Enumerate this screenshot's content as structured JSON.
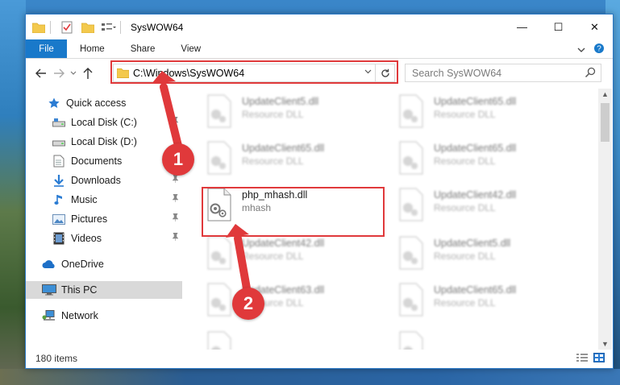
{
  "window": {
    "title": "SysWOW64",
    "controls": {
      "minimize": "—",
      "maximize": "☐",
      "close": "✕"
    }
  },
  "ribbon": {
    "tabs": [
      "File",
      "Home",
      "Share",
      "View"
    ]
  },
  "address_bar": {
    "path": "C:\\Windows\\SysWOW64"
  },
  "search": {
    "placeholder": "Search SysWOW64"
  },
  "sidebar": {
    "items": [
      {
        "label": "Quick access",
        "icon": "star-icon"
      },
      {
        "label": "Local Disk (C:)",
        "icon": "drive-icon"
      },
      {
        "label": "Local Disk (D:)",
        "icon": "drive-icon"
      },
      {
        "label": "Documents",
        "icon": "documents-icon"
      },
      {
        "label": "Downloads",
        "icon": "download-icon"
      },
      {
        "label": "Music",
        "icon": "music-icon"
      },
      {
        "label": "Pictures",
        "icon": "pictures-icon"
      },
      {
        "label": "Videos",
        "icon": "videos-icon"
      },
      {
        "label": "OneDrive",
        "icon": "cloud-icon"
      },
      {
        "label": "This PC",
        "icon": "computer-icon",
        "selected": true
      },
      {
        "label": "Network",
        "icon": "network-icon"
      }
    ]
  },
  "files": [
    {
      "name": "UpdateClient5.dll",
      "desc": "Resource DLL"
    },
    {
      "name": "UpdateClient65.dll",
      "desc": "Resource DLL"
    },
    {
      "name": "UpdateClient65.dll",
      "desc": "Resource DLL"
    },
    {
      "name": "UpdateClient65.dll",
      "desc": "Resource DLL"
    },
    {
      "name": "php_mhash.dll",
      "desc": "mhash"
    },
    {
      "name": "UpdateClient42.dll",
      "desc": "Resource DLL"
    },
    {
      "name": "UpdateClient42.dll",
      "desc": "Resource DLL"
    },
    {
      "name": "UpdateClient5.dll",
      "desc": "Resource DLL"
    },
    {
      "name": "UpdateClient63.dll",
      "desc": "Resource DLL"
    },
    {
      "name": "UpdateClient65.dll",
      "desc": "Resource DLL"
    }
  ],
  "status": {
    "item_count": "180 items"
  },
  "steps": {
    "step1": "1",
    "step2": "2"
  },
  "colors": {
    "accent_blue": "#1979ca",
    "highlight_red": "#e0393b",
    "selected_bg": "#d9d9d9"
  }
}
